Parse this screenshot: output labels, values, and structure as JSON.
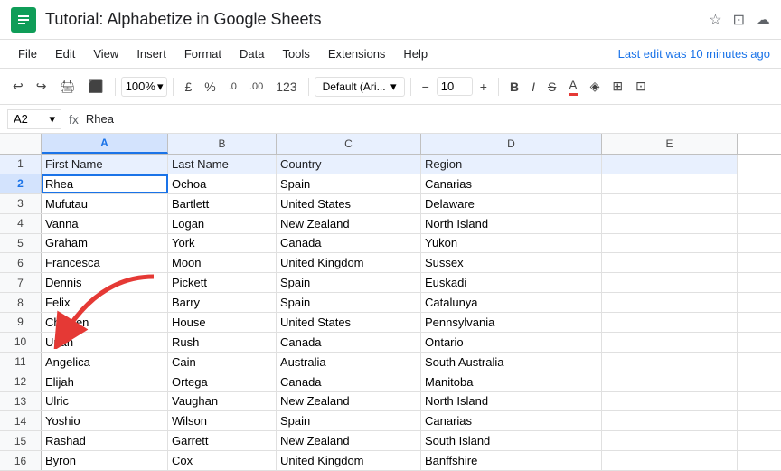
{
  "title": {
    "app_name": "Tutorial: Alphabetize in Google Sheets",
    "app_icon": "≡",
    "last_edit": "Last edit was 10 minutes ago"
  },
  "menu": {
    "items": [
      "File",
      "Edit",
      "View",
      "Insert",
      "Format",
      "Data",
      "Tools",
      "Extensions",
      "Help"
    ]
  },
  "toolbar": {
    "zoom": "100%",
    "currency": "£",
    "percent": "%",
    "decimal0": ".0",
    "decimal00": ".00",
    "number_format": "123",
    "font": "Default (Ari...",
    "font_size": "10",
    "bold": "B",
    "italic": "I",
    "strikethrough": "S"
  },
  "formula_bar": {
    "cell_ref": "A2",
    "formula": "Rhea"
  },
  "columns": {
    "headers": [
      "A",
      "B",
      "C",
      "D",
      "E"
    ],
    "widths": [
      140,
      120,
      160,
      200,
      150
    ]
  },
  "rows": [
    {
      "num": 1,
      "cells": [
        "First Name",
        "Last Name",
        "Country",
        "Region",
        ""
      ]
    },
    {
      "num": 2,
      "cells": [
        "Rhea",
        "Ochoa",
        "Spain",
        "Canarias",
        ""
      ]
    },
    {
      "num": 3,
      "cells": [
        "Mufutau",
        "Bartlett",
        "United States",
        "Delaware",
        ""
      ]
    },
    {
      "num": 4,
      "cells": [
        "Vanna",
        "Logan",
        "New Zealand",
        "North Island",
        ""
      ]
    },
    {
      "num": 5,
      "cells": [
        "Graham",
        "York",
        "Canada",
        "Yukon",
        ""
      ]
    },
    {
      "num": 6,
      "cells": [
        "Francesca",
        "Moon",
        "United Kingdom",
        "Sussex",
        ""
      ]
    },
    {
      "num": 7,
      "cells": [
        "Dennis",
        "Pickett",
        "Spain",
        "Euskadi",
        ""
      ]
    },
    {
      "num": 8,
      "cells": [
        "Felix",
        "Barry",
        "Spain",
        "Catalunya",
        ""
      ]
    },
    {
      "num": 9,
      "cells": [
        "Christen",
        "House",
        "United States",
        "Pennsylvania",
        ""
      ]
    },
    {
      "num": 10,
      "cells": [
        "Uriah",
        "Rush",
        "Canada",
        "Ontario",
        ""
      ]
    },
    {
      "num": 11,
      "cells": [
        "Angelica",
        "Cain",
        "Australia",
        "South Australia",
        ""
      ]
    },
    {
      "num": 12,
      "cells": [
        "Elijah",
        "Ortega",
        "Canada",
        "Manitoba",
        ""
      ]
    },
    {
      "num": 13,
      "cells": [
        "Ulric",
        "Vaughan",
        "New Zealand",
        "North Island",
        ""
      ]
    },
    {
      "num": 14,
      "cells": [
        "Yoshio",
        "Wilson",
        "Spain",
        "Canarias",
        ""
      ]
    },
    {
      "num": 15,
      "cells": [
        "Rashad",
        "Garrett",
        "New Zealand",
        "South Island",
        ""
      ]
    },
    {
      "num": 16,
      "cells": [
        "Byron",
        "Cox",
        "United Kingdom",
        "Banffshire",
        ""
      ]
    }
  ]
}
